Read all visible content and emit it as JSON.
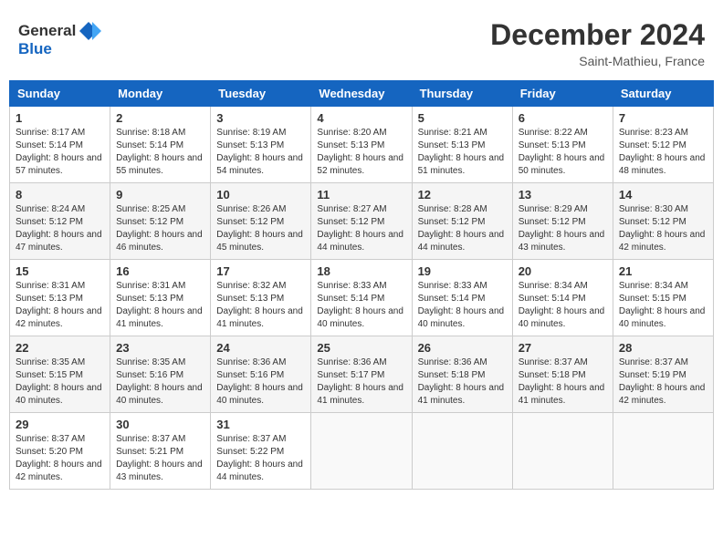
{
  "header": {
    "logo_general": "General",
    "logo_blue": "Blue",
    "month_title": "December 2024",
    "location": "Saint-Mathieu, France"
  },
  "days_of_week": [
    "Sunday",
    "Monday",
    "Tuesday",
    "Wednesday",
    "Thursday",
    "Friday",
    "Saturday"
  ],
  "weeks": [
    [
      {
        "day": "1",
        "sunrise": "8:17 AM",
        "sunset": "5:14 PM",
        "daylight": "8 hours and 57 minutes."
      },
      {
        "day": "2",
        "sunrise": "8:18 AM",
        "sunset": "5:14 PM",
        "daylight": "8 hours and 55 minutes."
      },
      {
        "day": "3",
        "sunrise": "8:19 AM",
        "sunset": "5:13 PM",
        "daylight": "8 hours and 54 minutes."
      },
      {
        "day": "4",
        "sunrise": "8:20 AM",
        "sunset": "5:13 PM",
        "daylight": "8 hours and 52 minutes."
      },
      {
        "day": "5",
        "sunrise": "8:21 AM",
        "sunset": "5:13 PM",
        "daylight": "8 hours and 51 minutes."
      },
      {
        "day": "6",
        "sunrise": "8:22 AM",
        "sunset": "5:13 PM",
        "daylight": "8 hours and 50 minutes."
      },
      {
        "day": "7",
        "sunrise": "8:23 AM",
        "sunset": "5:12 PM",
        "daylight": "8 hours and 48 minutes."
      }
    ],
    [
      {
        "day": "8",
        "sunrise": "8:24 AM",
        "sunset": "5:12 PM",
        "daylight": "8 hours and 47 minutes."
      },
      {
        "day": "9",
        "sunrise": "8:25 AM",
        "sunset": "5:12 PM",
        "daylight": "8 hours and 46 minutes."
      },
      {
        "day": "10",
        "sunrise": "8:26 AM",
        "sunset": "5:12 PM",
        "daylight": "8 hours and 45 minutes."
      },
      {
        "day": "11",
        "sunrise": "8:27 AM",
        "sunset": "5:12 PM",
        "daylight": "8 hours and 44 minutes."
      },
      {
        "day": "12",
        "sunrise": "8:28 AM",
        "sunset": "5:12 PM",
        "daylight": "8 hours and 44 minutes."
      },
      {
        "day": "13",
        "sunrise": "8:29 AM",
        "sunset": "5:12 PM",
        "daylight": "8 hours and 43 minutes."
      },
      {
        "day": "14",
        "sunrise": "8:30 AM",
        "sunset": "5:12 PM",
        "daylight": "8 hours and 42 minutes."
      }
    ],
    [
      {
        "day": "15",
        "sunrise": "8:31 AM",
        "sunset": "5:13 PM",
        "daylight": "8 hours and 42 minutes."
      },
      {
        "day": "16",
        "sunrise": "8:31 AM",
        "sunset": "5:13 PM",
        "daylight": "8 hours and 41 minutes."
      },
      {
        "day": "17",
        "sunrise": "8:32 AM",
        "sunset": "5:13 PM",
        "daylight": "8 hours and 41 minutes."
      },
      {
        "day": "18",
        "sunrise": "8:33 AM",
        "sunset": "5:14 PM",
        "daylight": "8 hours and 40 minutes."
      },
      {
        "day": "19",
        "sunrise": "8:33 AM",
        "sunset": "5:14 PM",
        "daylight": "8 hours and 40 minutes."
      },
      {
        "day": "20",
        "sunrise": "8:34 AM",
        "sunset": "5:14 PM",
        "daylight": "8 hours and 40 minutes."
      },
      {
        "day": "21",
        "sunrise": "8:34 AM",
        "sunset": "5:15 PM",
        "daylight": "8 hours and 40 minutes."
      }
    ],
    [
      {
        "day": "22",
        "sunrise": "8:35 AM",
        "sunset": "5:15 PM",
        "daylight": "8 hours and 40 minutes."
      },
      {
        "day": "23",
        "sunrise": "8:35 AM",
        "sunset": "5:16 PM",
        "daylight": "8 hours and 40 minutes."
      },
      {
        "day": "24",
        "sunrise": "8:36 AM",
        "sunset": "5:16 PM",
        "daylight": "8 hours and 40 minutes."
      },
      {
        "day": "25",
        "sunrise": "8:36 AM",
        "sunset": "5:17 PM",
        "daylight": "8 hours and 41 minutes."
      },
      {
        "day": "26",
        "sunrise": "8:36 AM",
        "sunset": "5:18 PM",
        "daylight": "8 hours and 41 minutes."
      },
      {
        "day": "27",
        "sunrise": "8:37 AM",
        "sunset": "5:18 PM",
        "daylight": "8 hours and 41 minutes."
      },
      {
        "day": "28",
        "sunrise": "8:37 AM",
        "sunset": "5:19 PM",
        "daylight": "8 hours and 42 minutes."
      }
    ],
    [
      {
        "day": "29",
        "sunrise": "8:37 AM",
        "sunset": "5:20 PM",
        "daylight": "8 hours and 42 minutes."
      },
      {
        "day": "30",
        "sunrise": "8:37 AM",
        "sunset": "5:21 PM",
        "daylight": "8 hours and 43 minutes."
      },
      {
        "day": "31",
        "sunrise": "8:37 AM",
        "sunset": "5:22 PM",
        "daylight": "8 hours and 44 minutes."
      },
      null,
      null,
      null,
      null
    ]
  ],
  "labels": {
    "sunrise": "Sunrise:",
    "sunset": "Sunset:",
    "daylight": "Daylight:"
  }
}
